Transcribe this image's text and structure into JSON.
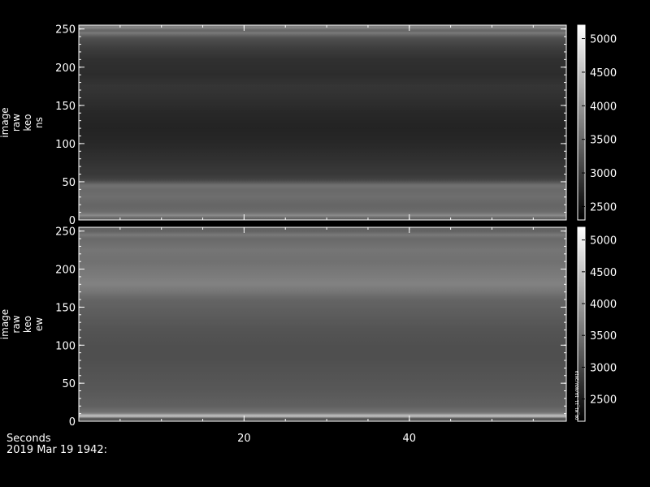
{
  "chart_data": [
    {
      "type": "heatmap",
      "ylabel": [
        "image",
        "raw",
        "keo",
        "ns"
      ],
      "ylim": [
        0,
        255
      ],
      "xlim": [
        0,
        59
      ],
      "yticks": [
        0,
        50,
        100,
        150,
        200,
        250
      ],
      "xticks": [
        20,
        40
      ],
      "colorbar": {
        "range": [
          2300,
          5200
        ],
        "ticks": [
          2500,
          3000,
          3500,
          4000,
          4500,
          5000
        ]
      },
      "profile": {
        "rows": [
          0,
          3,
          6,
          9,
          12,
          20,
          30,
          40,
          45,
          48,
          52,
          56,
          60,
          80,
          100,
          120,
          140,
          160,
          175,
          190,
          210,
          225,
          238,
          242,
          245,
          248,
          252,
          255
        ],
        "values": [
          3300,
          3500,
          3900,
          3600,
          3500,
          3450,
          3550,
          3500,
          3600,
          3400,
          3100,
          3000,
          2950,
          2850,
          2750,
          2700,
          2750,
          2850,
          2900,
          2800,
          2850,
          3000,
          3200,
          3450,
          3700,
          3350,
          3900,
          3600
        ]
      }
    },
    {
      "type": "heatmap",
      "ylabel": [
        "image",
        "raw",
        "keo",
        "ew"
      ],
      "ylim": [
        0,
        255
      ],
      "xlim": [
        0,
        59
      ],
      "yticks": [
        0,
        50,
        100,
        150,
        200,
        250
      ],
      "xticks": [
        20,
        40
      ],
      "colorbar": {
        "range": [
          2150,
          5200
        ],
        "ticks": [
          2500,
          3000,
          3500,
          4000,
          4500,
          5000
        ]
      },
      "colorbar_note": "DR_M1_11 19/NOV/2019",
      "profile": {
        "rows": [
          0,
          4,
          7,
          9,
          12,
          20,
          40,
          60,
          80,
          100,
          120,
          140,
          150,
          160,
          170,
          180,
          195,
          210,
          225,
          240,
          245,
          250,
          255
        ],
        "values": [
          3000,
          3300,
          4800,
          3900,
          3500,
          3300,
          3200,
          3150,
          3100,
          3100,
          3150,
          3250,
          3300,
          3350,
          3550,
          3700,
          3600,
          3500,
          3550,
          3400,
          3600,
          3300,
          3400
        ]
      }
    }
  ],
  "footer": {
    "x_axis_label": "Seconds",
    "date_label": "2019 Mar 19 1942:"
  }
}
